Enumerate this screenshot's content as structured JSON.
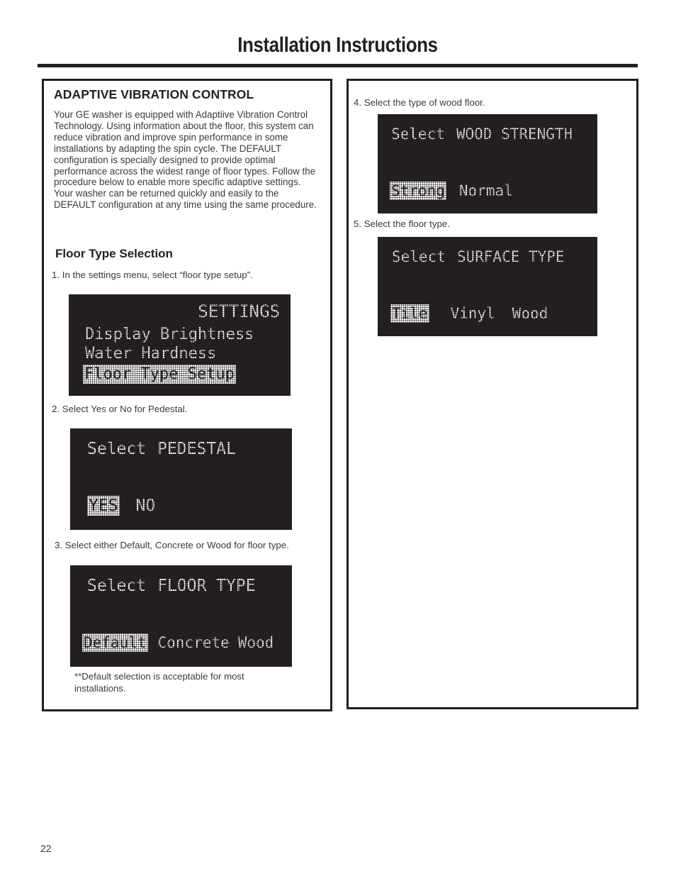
{
  "header": {
    "title": "Installation Instructions"
  },
  "left_panel": {
    "section_heading": "ADAPTIVE VIBRATION CONTROL",
    "intro_paragraph": "Your GE washer is equipped with Adaptiive Vibration Control Technology. Using information about the floor, this system can reduce vibration and improve spin performance in some installations by adapting the spin cycle. The DEFAULT configuration is specially designed to provide optimal performance across the widest range of floor types. Follow the procedure below to enable more specific adaptive settings. Your washer can be returned quickly and easily to the DEFAULT configuration at any time using the same procedure.",
    "sub_heading": "Floor Type Selection",
    "step1": "1. In the settings menu, select “floor type setup”.",
    "step2": "2. Select Yes or No for Pedestal.",
    "step3": "3. Select either Default, Concrete or Wood for floor type.",
    "note": "**Default selection is acceptable for most installations."
  },
  "right_panel": {
    "step4": "4. Select the type of wood floor.",
    "step5": "5. Select the floor type."
  },
  "screens": {
    "settings": {
      "name": "settings-menu-screen",
      "title": "SETTINGS",
      "items": [
        {
          "label": "Display Brightness",
          "selected": false
        },
        {
          "label": "Water Hardness",
          "selected": false
        },
        {
          "label": "Floor Type Setup",
          "selected": true
        }
      ]
    },
    "pedestal": {
      "name": "select-pedestal-screen",
      "title_prefix": "Select",
      "title_main": "PEDESTAL",
      "options": [
        {
          "label": "YES",
          "selected": true
        },
        {
          "label": "NO",
          "selected": false
        }
      ]
    },
    "floor_type": {
      "name": "select-floor-type-screen",
      "title_prefix": "Select",
      "title_main": "FLOOR TYPE",
      "options": [
        {
          "label": "Default",
          "selected": true
        },
        {
          "label": "Concrete",
          "selected": false
        },
        {
          "label": "Wood",
          "selected": false
        }
      ]
    },
    "wood_strength": {
      "name": "select-wood-strength-screen",
      "title_prefix": "Select",
      "title_main": "WOOD STRENGTH",
      "options": [
        {
          "label": "Strong",
          "selected": true
        },
        {
          "label": "Normal",
          "selected": false
        }
      ]
    },
    "surface_type": {
      "name": "select-surface-type-screen",
      "title_prefix": "Select",
      "title_main": "SURFACE TYPE",
      "options": [
        {
          "label": "Tile",
          "selected": true
        },
        {
          "label": "Vinyl",
          "selected": false
        },
        {
          "label": "Wood",
          "selected": false
        }
      ]
    }
  },
  "footer": {
    "page_number": "22"
  },
  "colors": {
    "ink": "#231f20",
    "body_text": "#3a3a3c",
    "lcd_background": "#231f20",
    "lcd_pixel": "#ffffff"
  }
}
